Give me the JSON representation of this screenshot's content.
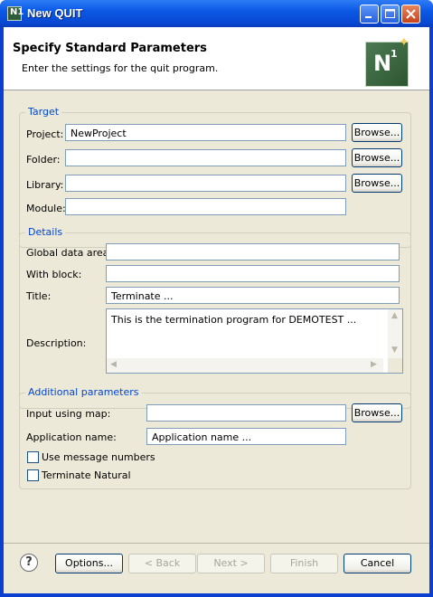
{
  "window": {
    "title": "New QUIT",
    "app_icon": "N1"
  },
  "header": {
    "title": "Specify Standard Parameters",
    "description": "Enter the settings for the quit program.",
    "logo_letter": "N",
    "logo_superscript": "1"
  },
  "target": {
    "legend": "Target",
    "project_label": "Project:",
    "project_value": "NewProject",
    "folder_label": "Folder:",
    "folder_value": "",
    "library_label": "Library:",
    "library_value": "",
    "module_label": "Module:",
    "module_value": "",
    "browse_label": "Browse..."
  },
  "details": {
    "legend": "Details",
    "gda_label": "Global data area:",
    "gda_value": "",
    "with_block_label": "With block:",
    "with_block_value": "",
    "title_label": "Title:",
    "title_value": "Terminate ...",
    "description_label": "Description:",
    "description_value": "This is the termination program for DEMOTEST ..."
  },
  "additional": {
    "legend": "Additional parameters",
    "input_map_label": "Input using map:",
    "input_map_value": "",
    "browse_label": "Browse...",
    "app_name_label": "Application name:",
    "app_name_value": "Application name ...",
    "use_msg_numbers_label": "Use message numbers",
    "use_msg_numbers_checked": false,
    "terminate_natural_label": "Terminate Natural",
    "terminate_natural_checked": false
  },
  "footer": {
    "help_symbol": "?",
    "options_label": "Options...",
    "back_label": "< Back",
    "next_label": "Next >",
    "finish_label": "Finish",
    "cancel_label": "Cancel"
  },
  "colors": {
    "titlebar": "#0b59e6",
    "group_legend": "#0046d5",
    "dialog_bg": "#ece9d8"
  },
  "icons": [
    "app-icon",
    "minimize-icon",
    "maximize-icon",
    "close-icon",
    "natural-logo",
    "help-icon",
    "scroll-up-icon",
    "scroll-down-icon",
    "scroll-left-icon",
    "scroll-right-icon"
  ]
}
